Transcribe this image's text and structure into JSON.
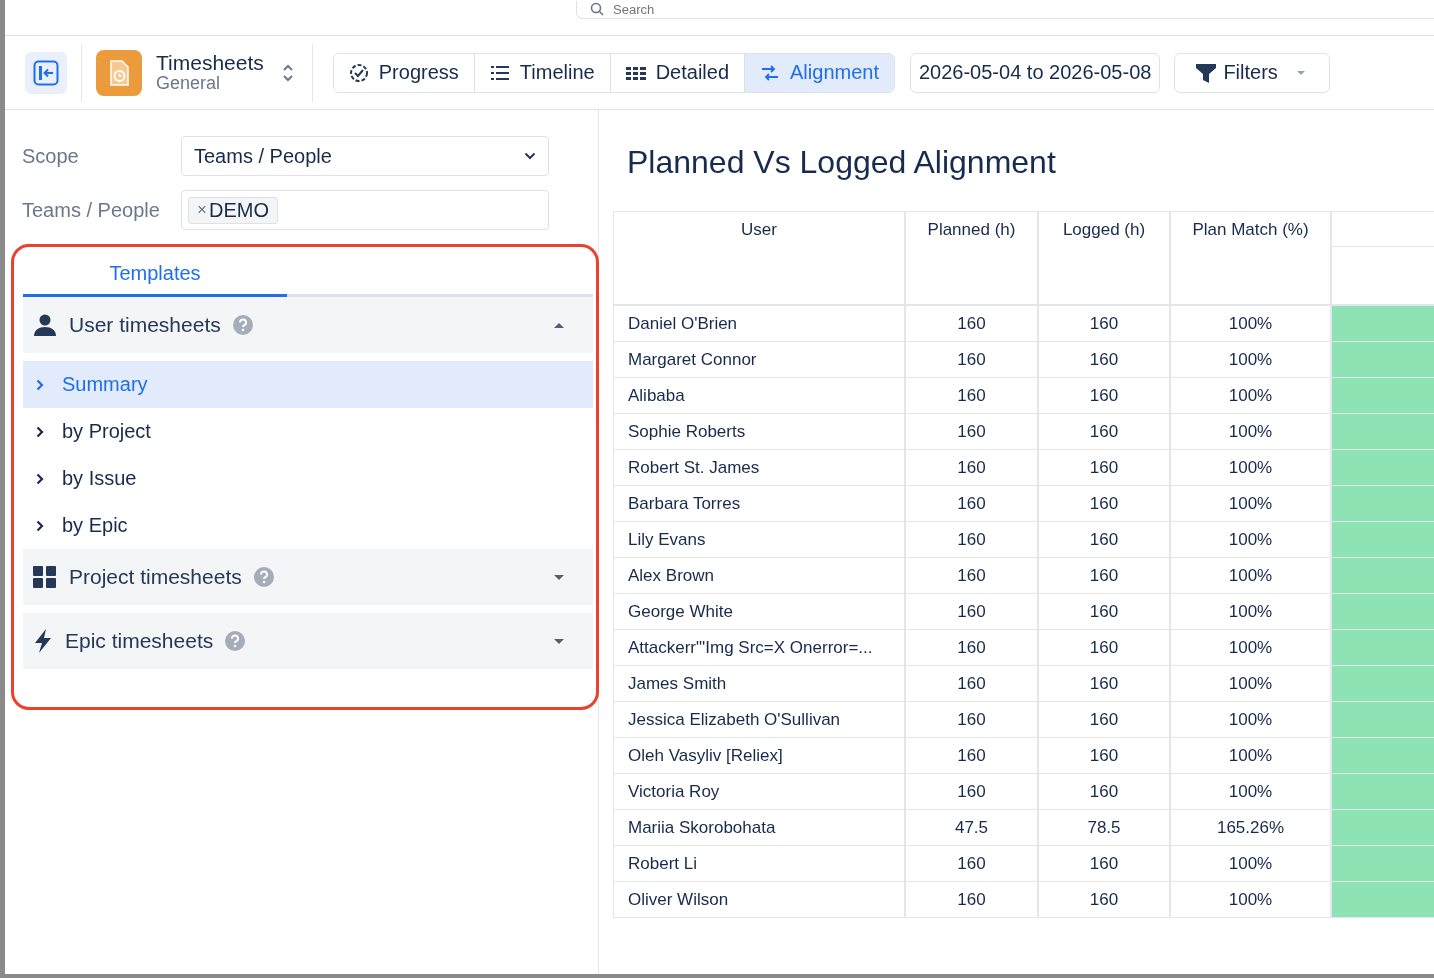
{
  "search": {
    "placeholder": "Search"
  },
  "toolbar": {
    "app": {
      "title": "Timesheets",
      "subtitle": "General"
    },
    "views": [
      {
        "label": "Progress",
        "kind": "progress",
        "selected": false
      },
      {
        "label": "Timeline",
        "kind": "timeline",
        "selected": false
      },
      {
        "label": "Detailed",
        "kind": "detailed",
        "selected": false
      },
      {
        "label": "Alignment",
        "kind": "alignment",
        "selected": true
      }
    ],
    "date_range": "2026-05-04 to 2026-05-08",
    "filters": "Filters"
  },
  "sidebar": {
    "scope_label": "Scope",
    "scope_value": "Teams / People",
    "people_label": "Teams / People",
    "people_tags": [
      {
        "remove": "×",
        "label": "DEMO"
      }
    ],
    "templates": {
      "highlighted": true,
      "tabs": [
        {
          "label": "Templates",
          "selected": true
        }
      ],
      "groups": [
        {
          "label": "User timesheets",
          "kind": "user",
          "expanded": true,
          "items": [
            {
              "label": "Summary",
              "selected": true
            },
            {
              "label": "by Project",
              "selected": false
            },
            {
              "label": "by Issue",
              "selected": false
            },
            {
              "label": "by Epic",
              "selected": false
            }
          ]
        },
        {
          "label": "Project timesheets",
          "kind": "project",
          "expanded": false
        },
        {
          "label": "Epic timesheets",
          "kind": "epic",
          "expanded": false
        }
      ]
    }
  },
  "report": {
    "title": "Planned Vs Logged Alignment",
    "table": {
      "columns": [
        "User",
        "Planned (h)",
        "Logged (h)",
        "Plan Match (%)"
      ],
      "rows": [
        {
          "cells": [
            "Daniel O'Brien",
            "160",
            "160",
            "100%"
          ],
          "color": "#8ee3b5"
        },
        {
          "cells": [
            "Margaret Connor",
            "160",
            "160",
            "100%"
          ],
          "color": "#8ee3b5"
        },
        {
          "cells": [
            "Alibaba",
            "160",
            "160",
            "100%"
          ],
          "color": "#8ee3b5"
        },
        {
          "cells": [
            "Sophie Roberts",
            "160",
            "160",
            "100%"
          ],
          "color": "#8ee3b5"
        },
        {
          "cells": [
            "Robert St. James",
            "160",
            "160",
            "100%"
          ],
          "color": "#8ee3b5"
        },
        {
          "cells": [
            "Barbara Torres",
            "160",
            "160",
            "100%"
          ],
          "color": "#8ee3b5"
        },
        {
          "cells": [
            "Lily Evans",
            "160",
            "160",
            "100%"
          ],
          "color": "#8ee3b5"
        },
        {
          "cells": [
            "Alex Brown",
            "160",
            "160",
            "100%"
          ],
          "color": "#8ee3b5"
        },
        {
          "cells": [
            "George White",
            "160",
            "160",
            "100%"
          ],
          "color": "#8ee3b5"
        },
        {
          "cells": [
            "Attackerr\"'Img Src=X Onerror=...",
            "160",
            "160",
            "100%"
          ],
          "color": "#8ee3b5"
        },
        {
          "cells": [
            "James Smith",
            "160",
            "160",
            "100%"
          ],
          "color": "#8ee3b5"
        },
        {
          "cells": [
            "Jessica Elizabeth O'Sullivan",
            "160",
            "160",
            "100%"
          ],
          "color": "#8ee3b5"
        },
        {
          "cells": [
            "Oleh Vasyliv [Reliex]",
            "160",
            "160",
            "100%"
          ],
          "color": "#8ee3b5"
        },
        {
          "cells": [
            "Victoria Roy",
            "160",
            "160",
            "100%"
          ],
          "color": "#8ee3b5"
        },
        {
          "cells": [
            "Mariia Skorobohata",
            "47.5",
            "78.5",
            "165.26%"
          ],
          "color": "#8ee3b5"
        },
        {
          "cells": [
            "Robert Li",
            "160",
            "160",
            "100%"
          ],
          "color": "#8ee3b5"
        },
        {
          "cells": [
            "Oliver Wilson",
            "160",
            "160",
            "100%"
          ],
          "color": "#8ee3b5"
        }
      ]
    }
  }
}
